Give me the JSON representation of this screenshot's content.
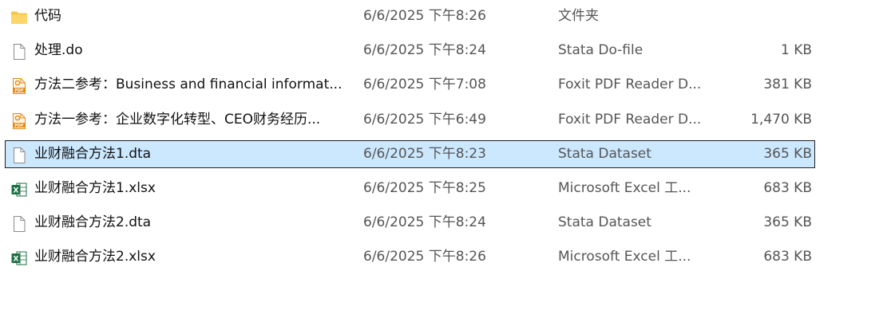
{
  "files": [
    {
      "name": "代码",
      "date": "6/6/2025 下午8:26",
      "type": "文件夹",
      "size": "",
      "icon": "folder-icon",
      "selected": false
    },
    {
      "name": "处理.do",
      "date": "6/6/2025 下午8:24",
      "type": "Stata Do-file",
      "size": "1 KB",
      "icon": "document-icon",
      "selected": false
    },
    {
      "name": "方法二参考：Business and financial informat...",
      "date": "6/6/2025 下午7:08",
      "type": "Foxit PDF Reader D...",
      "size": "381 KB",
      "icon": "pdf-icon",
      "selected": false
    },
    {
      "name": "方法一参考：企业数字化转型、CEO财务经历...",
      "date": "6/6/2025 下午6:49",
      "type": "Foxit PDF Reader D...",
      "size": "1,470 KB",
      "icon": "pdf-icon",
      "selected": false
    },
    {
      "name": "业财融合方法1.dta",
      "date": "6/6/2025 下午8:23",
      "type": "Stata Dataset",
      "size": "365 KB",
      "icon": "document-icon",
      "selected": true
    },
    {
      "name": "业财融合方法1.xlsx",
      "date": "6/6/2025 下午8:25",
      "type": "Microsoft Excel 工...",
      "size": "683 KB",
      "icon": "excel-icon",
      "selected": false
    },
    {
      "name": "业财融合方法2.dta",
      "date": "6/6/2025 下午8:24",
      "type": "Stata Dataset",
      "size": "365 KB",
      "icon": "document-icon",
      "selected": false
    },
    {
      "name": "业财融合方法2.xlsx",
      "date": "6/6/2025 下午8:26",
      "type": "Microsoft Excel 工...",
      "size": "683 KB",
      "icon": "excel-icon",
      "selected": false
    }
  ],
  "colors": {
    "selection_bg": "#cce8ff",
    "folder": "#f7c549",
    "pdf_accent": "#e8870e",
    "excel_green": "#1d7044"
  }
}
